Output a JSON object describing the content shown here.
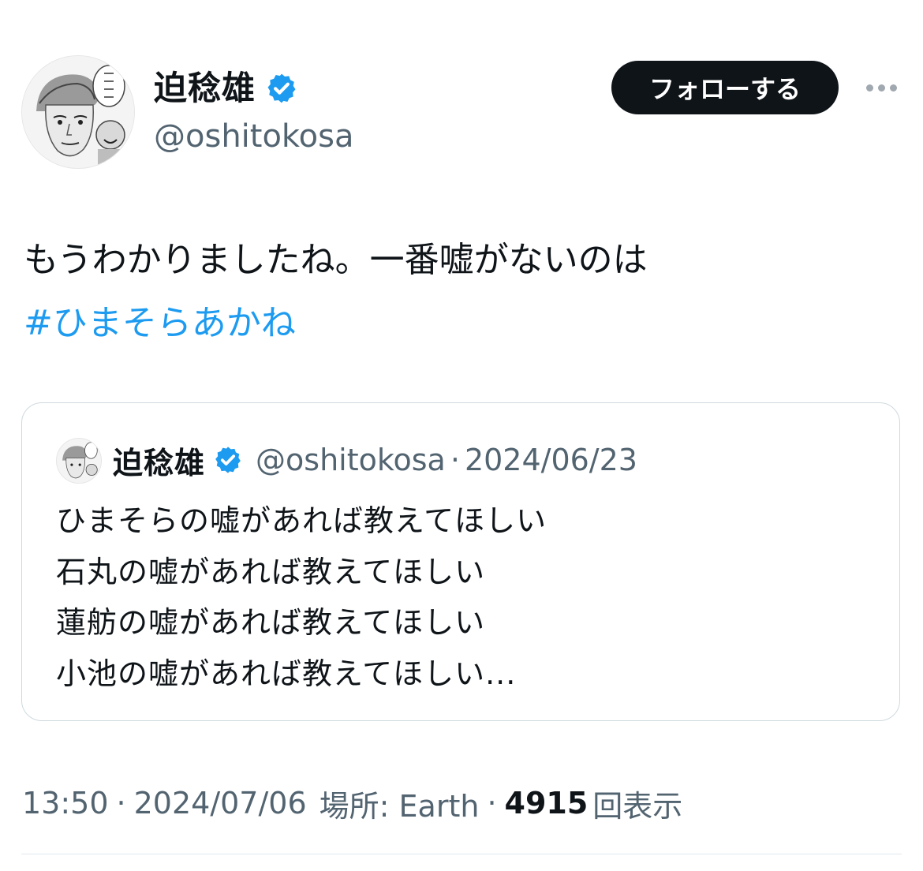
{
  "author": {
    "display_name": "迫稔雄",
    "handle": "@oshitokosa",
    "verified": true,
    "avatar_icon": "manga-portrait-avatar"
  },
  "actions": {
    "follow_label": "フォローする",
    "more_icon": "more-dots-icon"
  },
  "tweet": {
    "text": "もうわかりましたね。一番嘘がないのは",
    "hashtag": "#ひまそらあかね"
  },
  "quote": {
    "display_name": "迫稔雄",
    "handle": "@oshitokosa",
    "separator": "·",
    "date": "2024/06/23",
    "lines": [
      "ひまそらの嘘があれば教えてほしい",
      "石丸の嘘があれば教えてほしい",
      "蓮舫の嘘があれば教えてほしい",
      "小池の嘘があれば教えてほしい..."
    ]
  },
  "meta": {
    "time": "13:50",
    "separator": "·",
    "date": "2024/07/06",
    "location": "場所: Earth",
    "views_count": "4915",
    "views_label": "回表示"
  },
  "colors": {
    "text": "#0f1419",
    "secondary": "#536471",
    "link": "#1d9bf0",
    "verified": "#1d9bf0",
    "button_bg": "#0f1419",
    "border": "#cfd9de"
  }
}
